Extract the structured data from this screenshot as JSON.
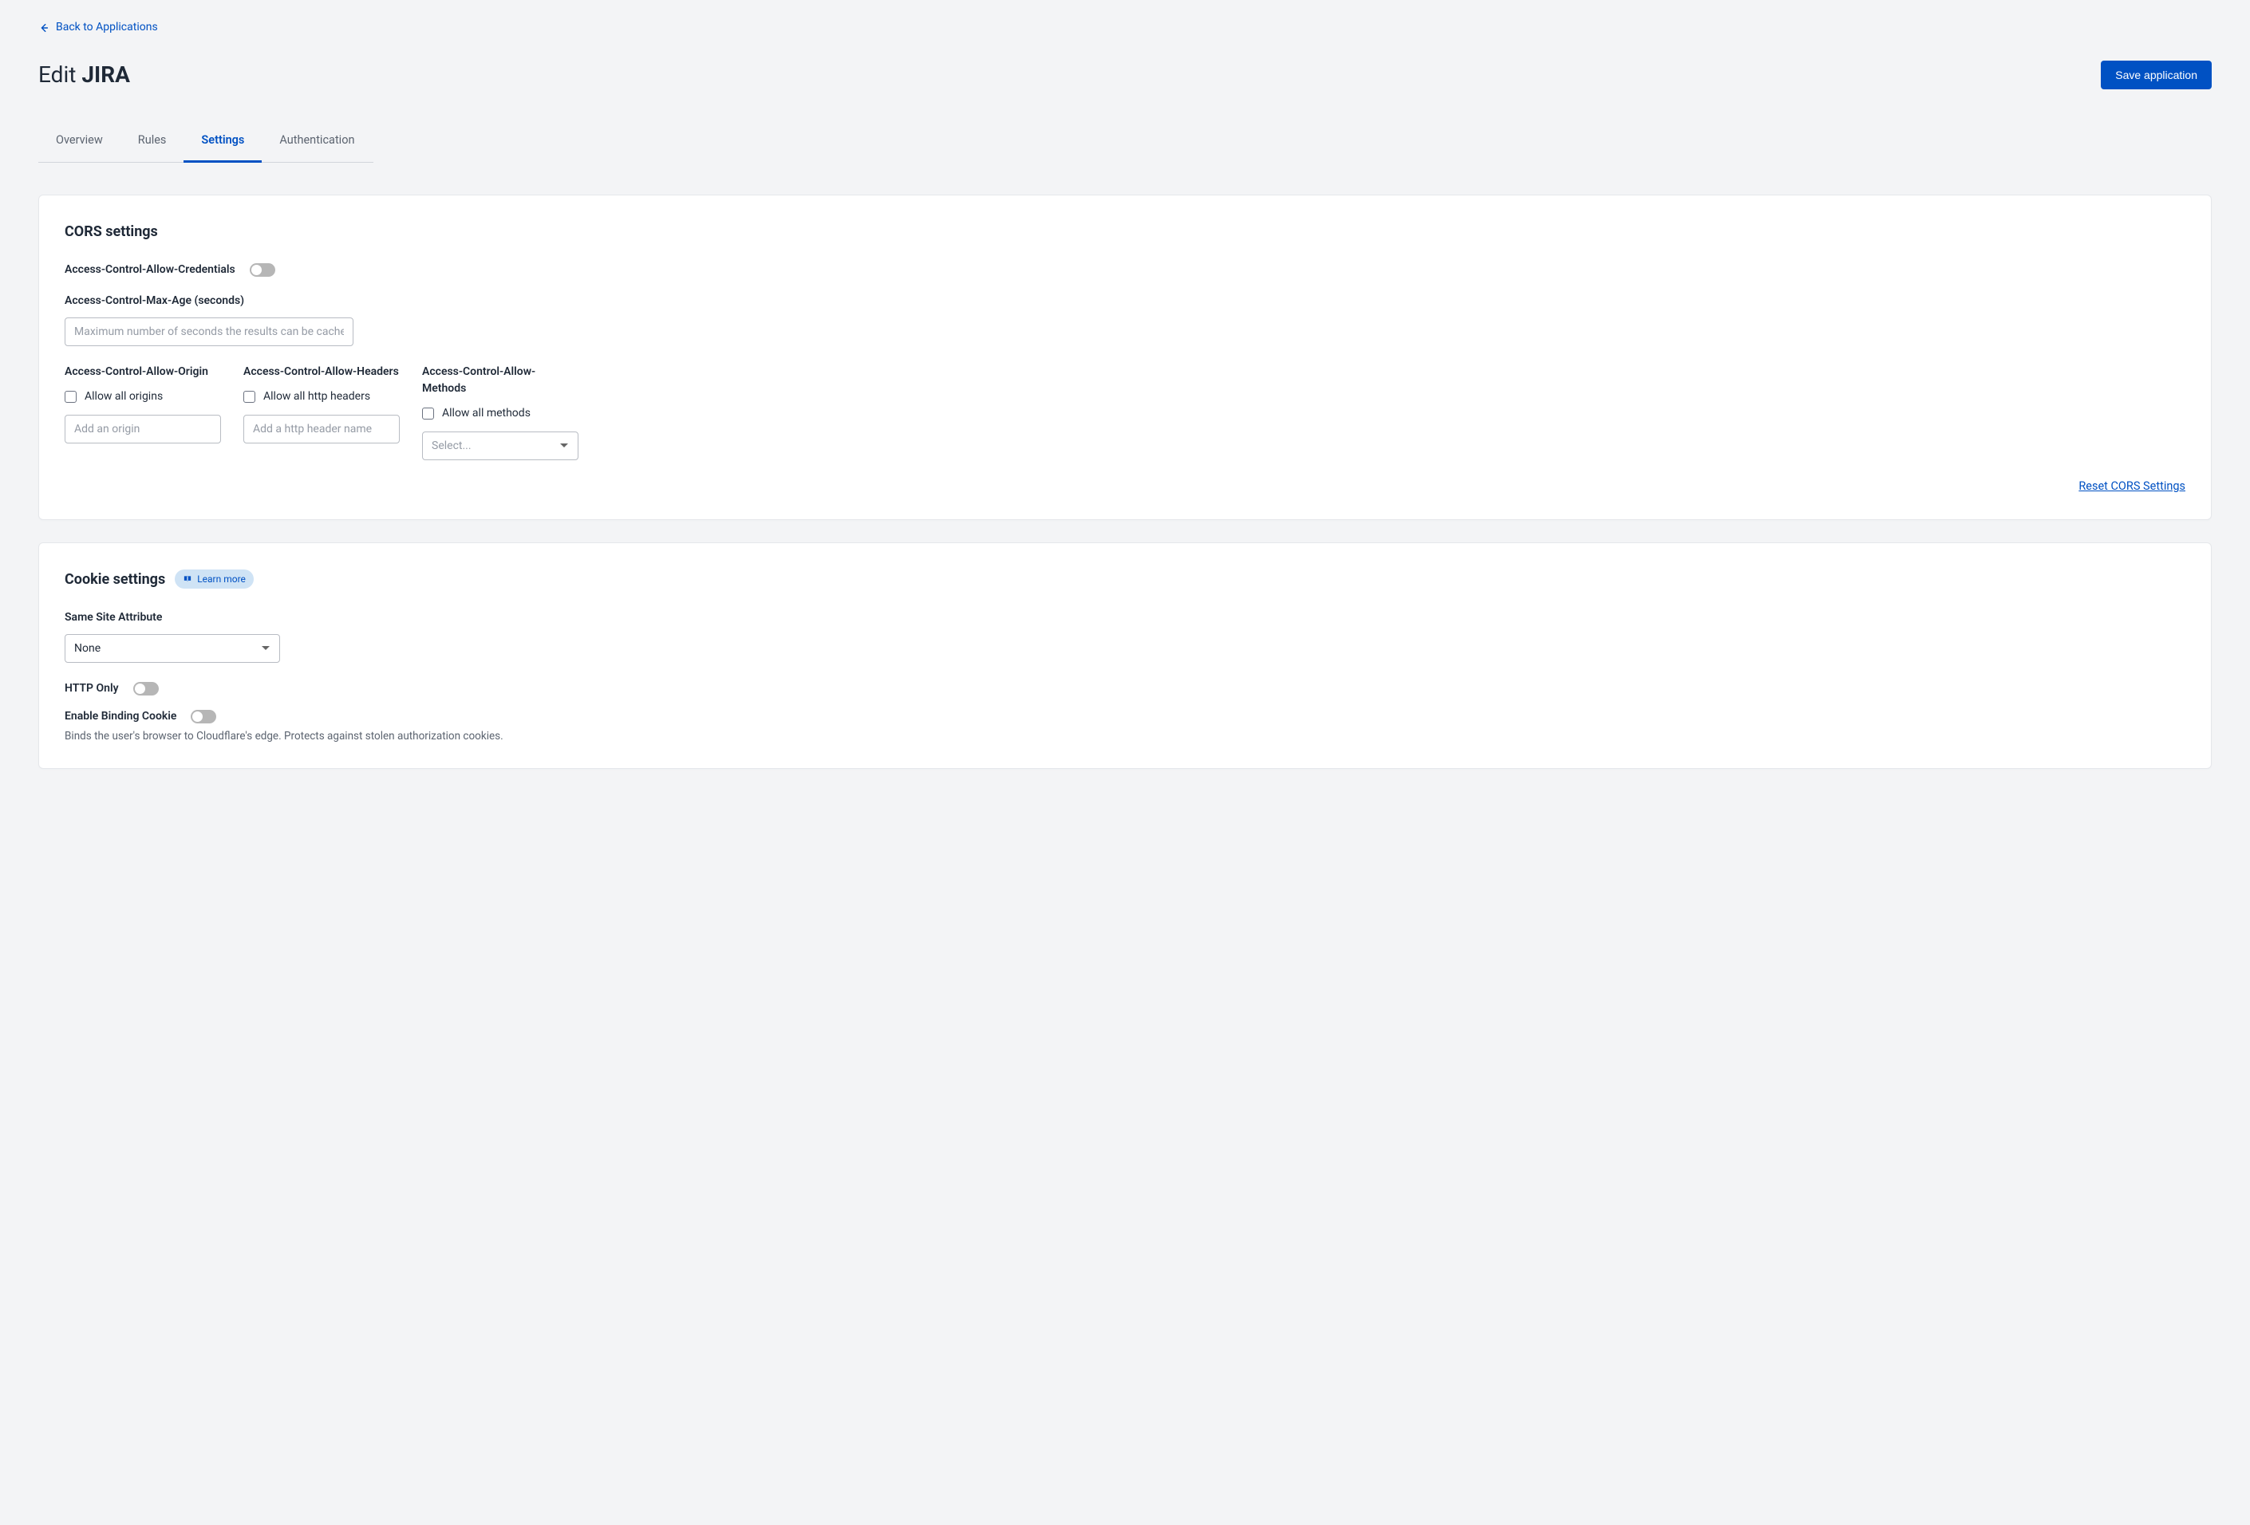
{
  "back": {
    "label": "Back to Applications"
  },
  "page": {
    "title_prefix": "Edit ",
    "title_name": "JIRA"
  },
  "actions": {
    "save": "Save application"
  },
  "tabs": {
    "overview": "Overview",
    "rules": "Rules",
    "settings": "Settings",
    "authentication": "Authentication",
    "active": "settings"
  },
  "cors": {
    "title": "CORS settings",
    "allow_credentials_label": "Access-Control-Allow-Credentials",
    "max_age_label": "Access-Control-Max-Age (seconds)",
    "max_age_placeholder": "Maximum number of seconds the results can be cached.",
    "origin": {
      "label": "Access-Control-Allow-Origin",
      "allow_all": "Allow all origins",
      "placeholder": "Add an origin"
    },
    "headers": {
      "label": "Access-Control-Allow-Headers",
      "allow_all": "Allow all http headers",
      "placeholder": "Add a http header name"
    },
    "methods": {
      "label": "Access-Control-Allow-Methods",
      "allow_all": "Allow all methods",
      "placeholder": "Select..."
    },
    "reset": "Reset CORS Settings"
  },
  "cookie": {
    "title": "Cookie settings",
    "learn_more": "Learn more",
    "same_site_label": "Same Site Attribute",
    "same_site_value": "None",
    "http_only_label": "HTTP Only",
    "binding_label": "Enable Binding Cookie",
    "binding_help": "Binds the user's browser to Cloudflare's edge. Protects against stolen authorization cookies."
  }
}
